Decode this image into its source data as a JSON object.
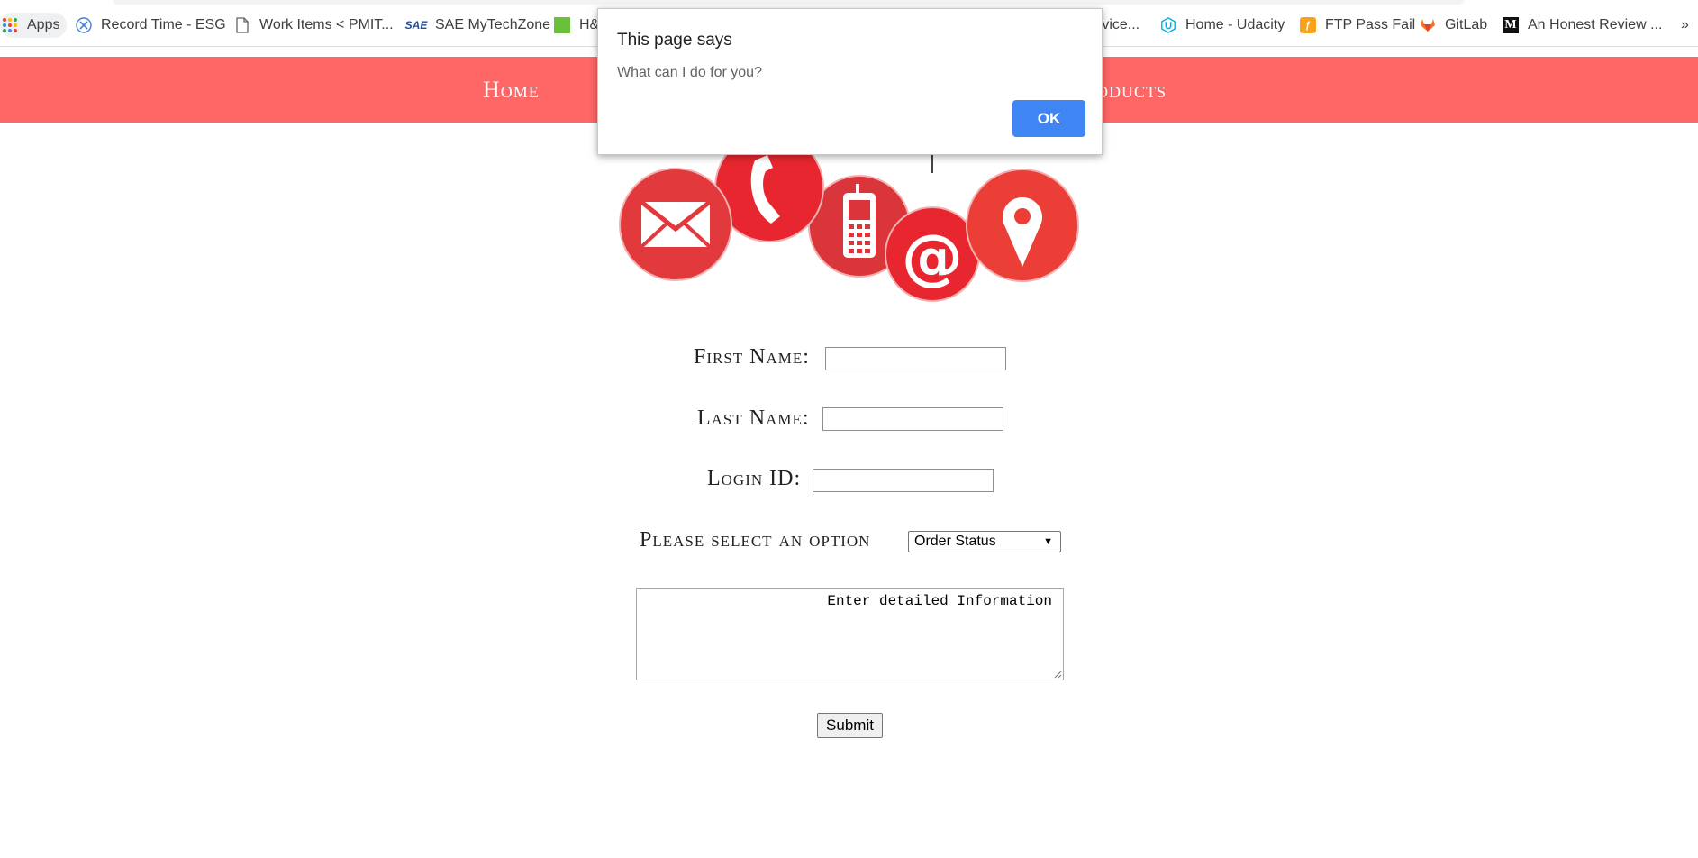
{
  "bookmarks": {
    "apps": "Apps",
    "items": [
      {
        "label": "Record Time - ESG",
        "icon": "x-circle-icon"
      },
      {
        "label": "Work Items < PMIT...",
        "icon": "page-icon"
      },
      {
        "label": "SAE MyTechZone",
        "icon": "sae-logo-icon"
      },
      {
        "label": "H&",
        "icon": "green-square-icon"
      },
      {
        "label": "rvice...",
        "icon": ""
      },
      {
        "label": "Home - Udacity",
        "icon": "udacity-icon"
      },
      {
        "label": "FTP Pass Fail",
        "icon": "ftp-icon"
      },
      {
        "label": "GitLab",
        "icon": "gitlab-icon"
      },
      {
        "label": "An Honest Review ...",
        "icon": "medium-icon"
      }
    ],
    "more": "»"
  },
  "nav": {
    "home": "Home",
    "products": "oducts"
  },
  "form": {
    "first_name_label": "First Name:",
    "last_name_label": "Last Name:",
    "login_id_label": "Login ID:",
    "option_label": "Please select an option",
    "option_selected": "Order Status",
    "details_text": "Enter detailed Information",
    "submit_label": "Submit"
  },
  "dialog": {
    "title": "This page says",
    "message": "What can I do for you?",
    "ok_label": "OK"
  },
  "colors": {
    "nav_bg": "#ff6666",
    "ok_button": "#3f86f4",
    "icon_red": "#e03c3c"
  }
}
